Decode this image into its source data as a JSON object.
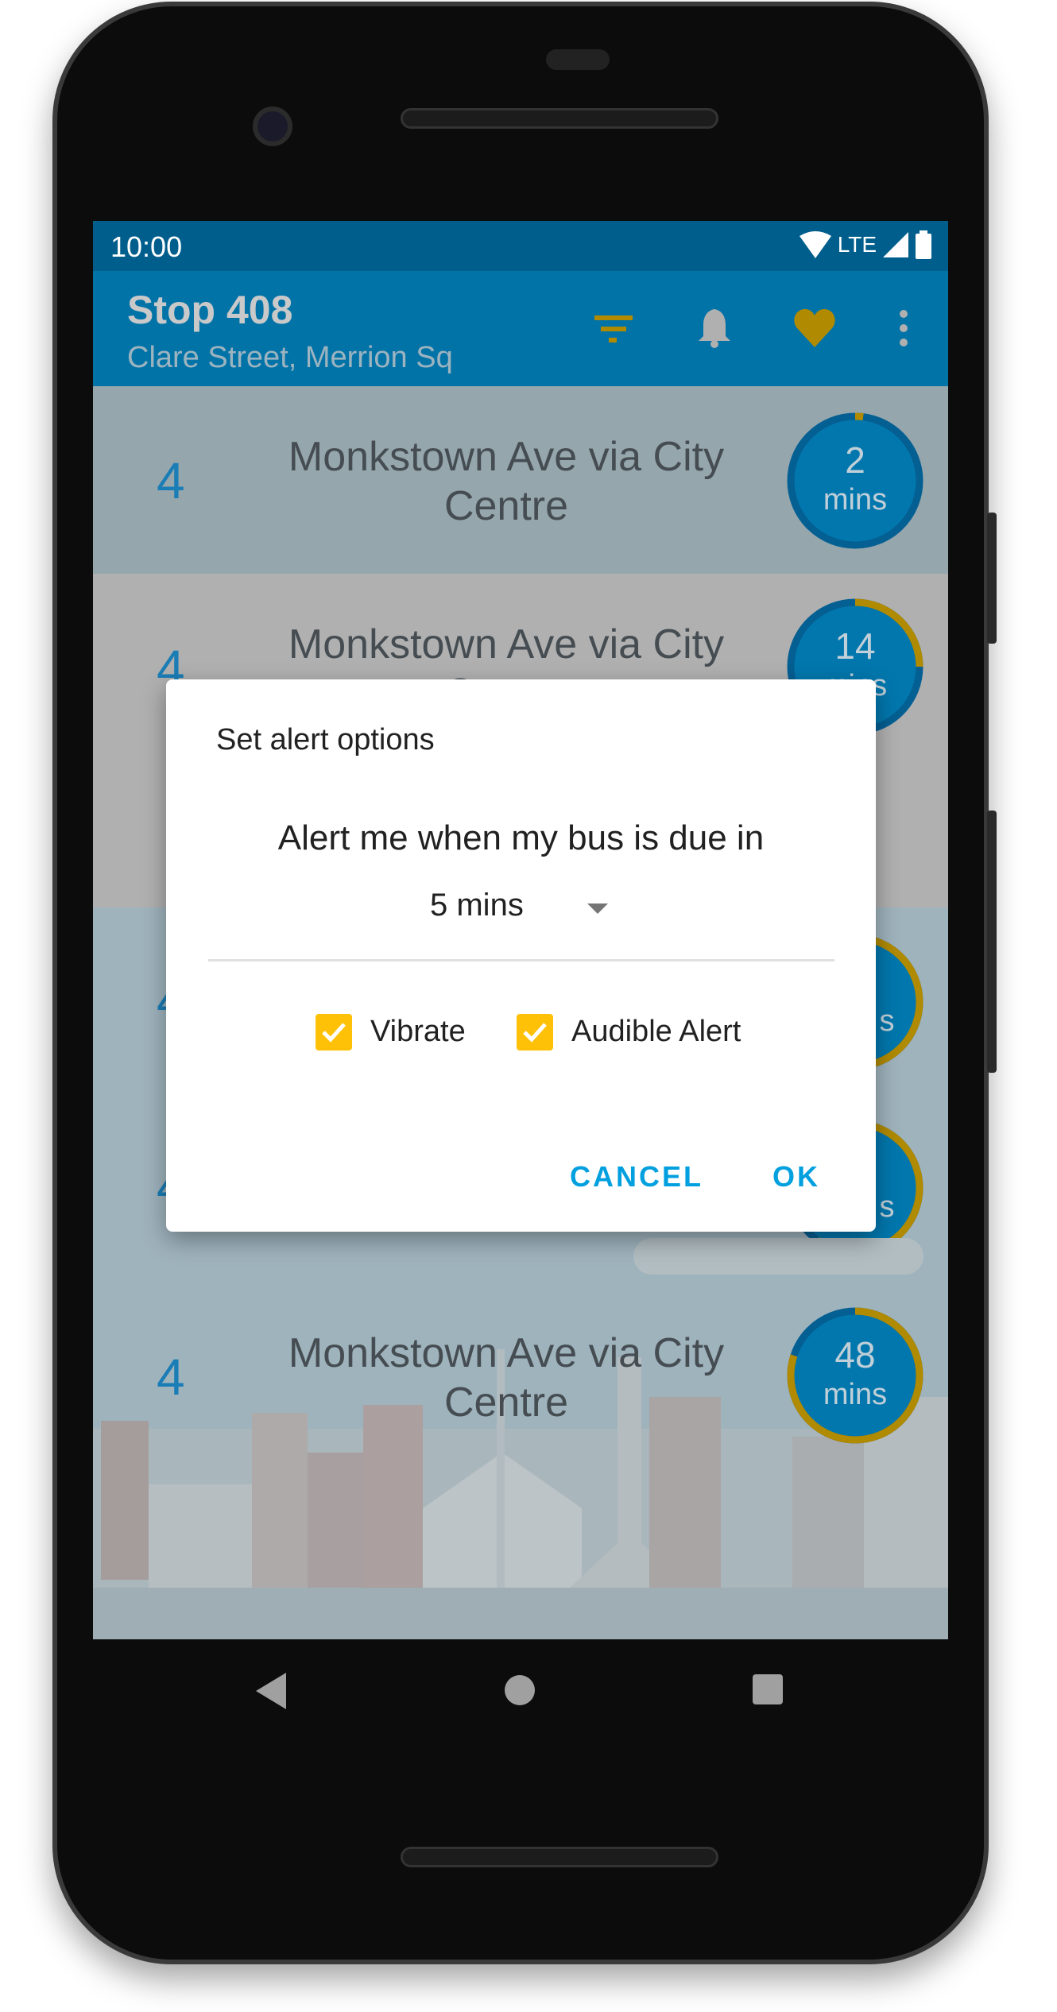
{
  "status_bar": {
    "time": "10:00",
    "network": "LTE",
    "icons": [
      "wifi-icon",
      "signal-icon",
      "battery-icon"
    ]
  },
  "app_bar": {
    "title": "Stop 408",
    "subtitle": "Clare Street, Merrion Sq",
    "actions": [
      {
        "name": "filter",
        "icon": "filter-icon",
        "color": "#b08a00"
      },
      {
        "name": "alert",
        "icon": "bell-icon",
        "color": "#b0b0b0"
      },
      {
        "name": "favourite",
        "icon": "heart-icon",
        "color": "#b08a00"
      },
      {
        "name": "more",
        "icon": "more-vert-icon",
        "color": "#b0b0b0"
      }
    ]
  },
  "arrivals": [
    {
      "route": "4",
      "destination_line1": "Monkstown Ave via City",
      "destination_line2": "Centre",
      "due": "2",
      "unit": "mins",
      "progress": 0.02
    },
    {
      "route": "4",
      "destination_line1": "Monkstown Ave via City",
      "destination_line2": "Centre",
      "due": "14",
      "unit": "mins",
      "progress": 0.25
    },
    {
      "route": "4",
      "destination_line1": "",
      "destination_line2": "",
      "due": "",
      "unit": "s",
      "progress": 0.5
    },
    {
      "route": "4",
      "destination_line1": "",
      "destination_line2": "",
      "due": "",
      "unit": "s",
      "progress": 0.6
    },
    {
      "route": "4",
      "destination_line1": "Monkstown Ave via City",
      "destination_line2": "Centre",
      "due": "48",
      "unit": "mins",
      "progress": 0.8
    }
  ],
  "dialog": {
    "title": "Set alert options",
    "message": "Alert me when my bus is due in",
    "due_selected": "5 mins",
    "options": [
      {
        "label": "Vibrate",
        "checked": true
      },
      {
        "label": "Audible Alert",
        "checked": true
      }
    ],
    "cancel_label": "CANCEL",
    "ok_label": "OK"
  },
  "colors": {
    "accent": "#03a0e0",
    "checkbox": "#ffc107",
    "primary": "#0273a7",
    "gold": "#b08a00"
  }
}
